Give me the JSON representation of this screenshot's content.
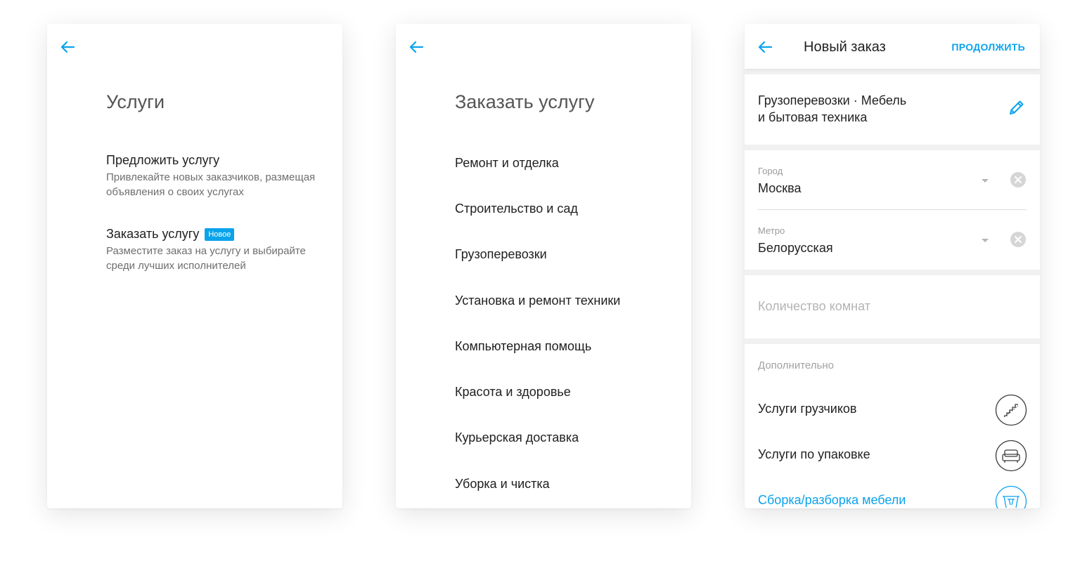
{
  "screens": {
    "services": {
      "title": "Услуги",
      "options": [
        {
          "title": "Предложить услугу",
          "description": "Привлекайте новых заказчиков, размещая объявления о своих услугах"
        },
        {
          "title": "Заказать услугу",
          "badge": "Новое",
          "description": "Разместите заказ на услугу и выбирайте среди лучших исполнителей"
        }
      ]
    },
    "order_service": {
      "title": "Заказать услугу",
      "categories": [
        "Ремонт и отделка",
        "Строительство и сад",
        "Грузоперевозки",
        "Установка и ремонт техники",
        "Компьютерная помощь",
        "Красота и здоровье",
        "Курьерская доставка",
        "Уборка и чистка"
      ]
    },
    "new_order": {
      "title": "Новый заказ",
      "continue_label": "ПРОДОЛЖИТЬ",
      "category_line1": "Грузоперевозки · Мебель",
      "category_line2": "и бытовая техника",
      "city": {
        "label": "Город",
        "value": "Москва"
      },
      "metro": {
        "label": "Метро",
        "value": "Белорусская"
      },
      "rooms_placeholder": "Количество комнат",
      "extras_title": "Дополнительно",
      "extras": [
        {
          "label": "Услуги грузчиков",
          "icon": "stairs-icon",
          "selected": false
        },
        {
          "label": "Услуги по упаковке",
          "icon": "sofa-icon",
          "selected": false
        },
        {
          "label": "Сборка/разборка мебели",
          "icon": "table-icon",
          "selected": true
        }
      ]
    }
  },
  "colors": {
    "accent": "#0aa3ec",
    "text": "#222222",
    "muted": "#6e6e6e",
    "placeholder": "#b4b4b4"
  }
}
